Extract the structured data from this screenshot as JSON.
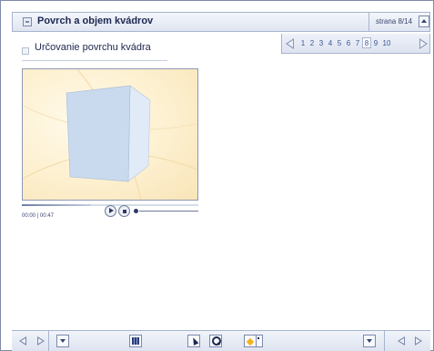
{
  "header": {
    "title": "Povrch a objem kvádrov",
    "title_icon": "minimize-icon",
    "page_indicator": "strana 8/14",
    "up_button_icon": "arrow-up-icon"
  },
  "section": {
    "heading": "Určovanie povrchu kvádra",
    "icon": "collapse-icon"
  },
  "pagination": {
    "pages": [
      "1",
      "2",
      "3",
      "4",
      "5",
      "6",
      "7",
      "8",
      "9",
      "10"
    ],
    "current_page": "8",
    "prev_icon": "triangle-left-icon",
    "next_icon": "triangle-right-icon"
  },
  "video": {
    "time_display": "00:00 | 00:47",
    "progress": 0.39,
    "controls": [
      "play-icon",
      "stop-icon",
      "volume-icon"
    ],
    "colors": {
      "background": "#fdf0cf",
      "box_front": "#c7d9ef",
      "box_side": "#e4eef9"
    }
  },
  "toolbar": {
    "left_icons": [
      "prev-icon",
      "next-icon",
      "dropdown-icon"
    ],
    "center_icons": [
      "calculator-icon",
      "cursor-icon",
      "zoom-icon",
      "marker-icon"
    ],
    "right_icons": [
      "dropdown-icon",
      "prev-icon",
      "next-icon"
    ]
  },
  "colors": {
    "accent": "#3c5596",
    "border": "#a8b4cf",
    "title_text": "#1c2750"
  }
}
